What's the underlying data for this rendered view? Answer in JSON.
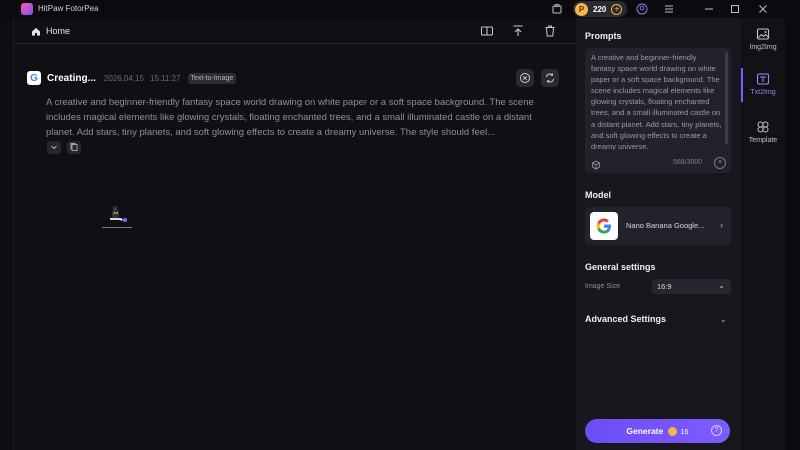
{
  "window": {
    "title": "HitPaw FotorPea",
    "credits": "220"
  },
  "header": {
    "home_label": "Home"
  },
  "task": {
    "title": "Creating...",
    "date": "2026.04.15",
    "time": "15:11:27",
    "tag": "Text-to-Image",
    "prompt": "A creative and beginner-friendly fantasy space world drawing on white paper or a soft space background. The scene includes magical elements like glowing crystals, floating enchanted trees, and a small illuminated castle on a distant planet. Add stars, tiny planets, and soft glowing effects to create a dreamy universe. The style should feel..."
  },
  "panel": {
    "prompts_heading": "Prompts",
    "prompt_text": "A creative and beginner-friendly fantasy space world drawing on white paper or a soft space background. The scene includes magical elements like glowing crystals, floating enchanted trees, and a small illuminated castle on a distant planet. Add stars, tiny planets, and soft glowing effects to create a dreamy universe.",
    "char_count": "568/3000",
    "model_heading": "Model",
    "model_name": "Nano Banana Google...",
    "general_heading": "General settings",
    "image_size_label": "Image Size",
    "image_size_value": "16:9",
    "advanced_heading": "Advanced Settings",
    "generate_label": "Generate",
    "generate_cost": "16"
  },
  "rail": {
    "items": [
      {
        "label": "Img2Img"
      },
      {
        "label": "Txt2Img"
      },
      {
        "label": "Template"
      }
    ]
  },
  "colors": {
    "accent": "#7b5cff",
    "coin": "#f4b64a"
  }
}
